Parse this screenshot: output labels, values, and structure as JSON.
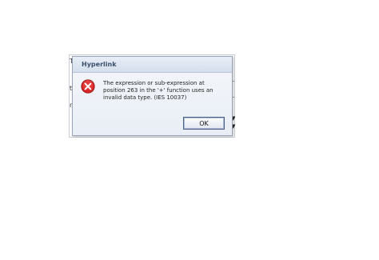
{
  "dialog": {
    "title": "Hyperlink",
    "message": "The expression or sub-expression at\nposition 263 in the '+' function uses an\ninvalid data type. (IES 10037)",
    "ok_label": "OK",
    "icon": "error-icon"
  },
  "background_fragments": {
    "f1": "T",
    "f2": "t",
    "f3": "n"
  },
  "colors": {
    "error_red": "#d82727",
    "title_text": "#3c4f6b"
  }
}
